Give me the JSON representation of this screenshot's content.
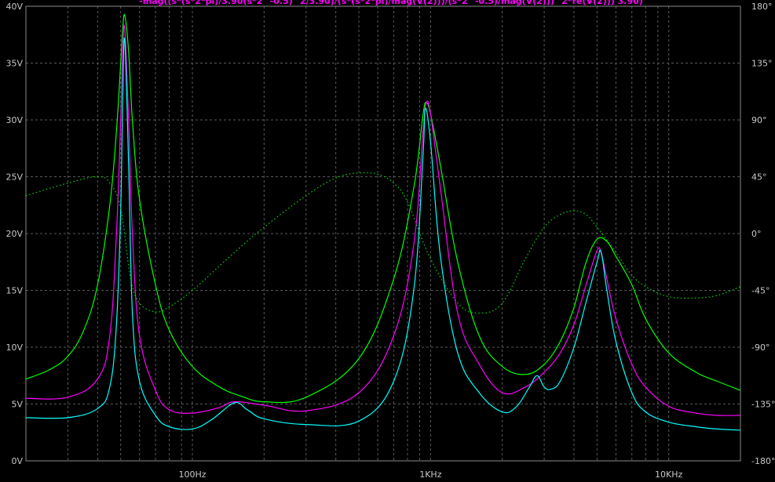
{
  "chart_data": {
    "type": "line",
    "title": "-mag((s*(s*2*pi)/3.90(s*2^-0.5)^2/3.90)/(s*(s*2*pi)/mag(V(2)))/(s*2^-0.5)/mag(V(2)))^2*re(V(2))) 3.90)",
    "x_scale": "log",
    "xlim": [
      20,
      20000
    ],
    "x_ticks": [
      {
        "value": 100,
        "label": "100Hz"
      },
      {
        "value": 1000,
        "label": "1KHz"
      },
      {
        "value": 10000,
        "label": "10KHz"
      }
    ],
    "y_left_range": [
      0,
      40
    ],
    "y_left_ticks": [
      "0V",
      "5V",
      "10V",
      "15V",
      "20V",
      "25V",
      "30V",
      "35V",
      "40V"
    ],
    "y_right_range": [
      -180,
      180
    ],
    "y_right_ticks": [
      "-180°",
      "-135°",
      "-90°",
      "-45°",
      "0°",
      "45°",
      "90°",
      "135°",
      "180°"
    ],
    "grid": true,
    "colors": {
      "background": "#000000",
      "grid": "#5a5a5a",
      "ticks": "#c8c8c8",
      "title": "#ff00ff"
    },
    "series": [
      {
        "color": "#00ff00",
        "style": "solid",
        "axis": "left",
        "x": [
          20,
          25,
          30,
          35,
          40,
          45,
          48,
          50,
          51,
          52,
          54,
          56,
          60,
          70,
          80,
          100,
          130,
          160,
          200,
          300,
          500,
          700,
          850,
          930,
          960,
          1000,
          1100,
          1300,
          1600,
          2000,
          2500,
          3000,
          3500,
          4000,
          4500,
          5000,
          5500,
          6000,
          7000,
          8000,
          10000,
          13000,
          16000,
          20000
        ],
        "y": [
          7.2,
          8.0,
          9.2,
          11.5,
          15.5,
          22.5,
          29,
          35,
          38,
          39.2,
          36,
          30,
          23,
          15.5,
          11.5,
          8.3,
          6.5,
          5.7,
          5.2,
          5.6,
          9,
          16,
          24,
          30.5,
          31.5,
          30.5,
          26,
          17.5,
          11,
          8.3,
          7.6,
          8.5,
          10.5,
          13.5,
          17.5,
          19.5,
          19.3,
          18,
          15.5,
          12.5,
          9.5,
          7.8,
          7.0,
          6.2
        ]
      },
      {
        "color": "#ff00ff",
        "style": "solid",
        "axis": "left",
        "x": [
          20,
          30,
          40,
          45,
          48,
          50,
          51,
          52,
          54,
          56,
          60,
          70,
          80,
          100,
          130,
          150,
          200,
          300,
          500,
          700,
          850,
          930,
          960,
          1000,
          1100,
          1300,
          1600,
          2000,
          2500,
          3000,
          3500,
          4000,
          4500,
          5000,
          5200,
          5500,
          6000,
          7000,
          8000,
          10000,
          13000,
          16000,
          20000
        ],
        "y": [
          5.5,
          5.6,
          7.2,
          11,
          20,
          30,
          36,
          38,
          30,
          20,
          11,
          6.2,
          4.5,
          4.2,
          4.7,
          5.2,
          4.9,
          4.4,
          6,
          11,
          19,
          29,
          31.5,
          30.5,
          24,
          13,
          8.5,
          6,
          6.5,
          7.8,
          9.5,
          12,
          15.5,
          18.5,
          18.3,
          16,
          12.5,
          8.5,
          6.5,
          4.8,
          4.2,
          4.0,
          4.0
        ]
      },
      {
        "color": "#00ffff",
        "style": "solid",
        "axis": "left",
        "x": [
          20,
          30,
          40,
          45,
          48,
          50,
          51,
          52,
          54,
          56,
          60,
          70,
          80,
          100,
          120,
          150,
          170,
          200,
          300,
          500,
          700,
          850,
          930,
          950,
          1000,
          1100,
          1300,
          1600,
          2000,
          2300,
          2600,
          2800,
          3000,
          3200,
          3500,
          4000,
          4500,
          5000,
          5200,
          5500,
          6000,
          7000,
          8000,
          10000,
          13000,
          16000,
          20000
        ],
        "y": [
          3.8,
          3.8,
          4.6,
          6.5,
          12,
          22,
          32,
          37,
          26,
          13,
          7,
          4,
          3,
          2.8,
          3.6,
          5.1,
          4.5,
          3.7,
          3.2,
          3.5,
          7,
          15,
          27,
          31,
          28,
          18,
          9.5,
          6,
          4.3,
          4.8,
          6.5,
          7.5,
          6.5,
          6.3,
          7,
          10,
          14,
          17.5,
          18.4,
          15,
          10.5,
          6,
          4.3,
          3.4,
          3.0,
          2.8,
          2.7
        ]
      },
      {
        "color": "#00dd00",
        "style": "dotted",
        "axis": "right",
        "x": [
          20,
          30,
          40,
          45,
          50,
          55,
          60,
          70,
          80,
          100,
          150,
          200,
          300,
          400,
          500,
          600,
          700,
          800,
          1000,
          1300,
          1600,
          2000,
          2500,
          3000,
          3500,
          4000,
          4500,
          5000,
          6000,
          7000,
          8000,
          10000,
          13000,
          16000,
          20000
        ],
        "y": [
          30,
          40,
          45,
          40,
          20,
          -35,
          -55,
          -62,
          -58,
          -45,
          -15,
          5,
          30,
          44,
          48,
          47,
          40,
          25,
          -20,
          -55,
          -63,
          -55,
          -20,
          5,
          15,
          18,
          15,
          5,
          -15,
          -33,
          -42,
          -50,
          -51,
          -49,
          -42
        ]
      }
    ]
  }
}
